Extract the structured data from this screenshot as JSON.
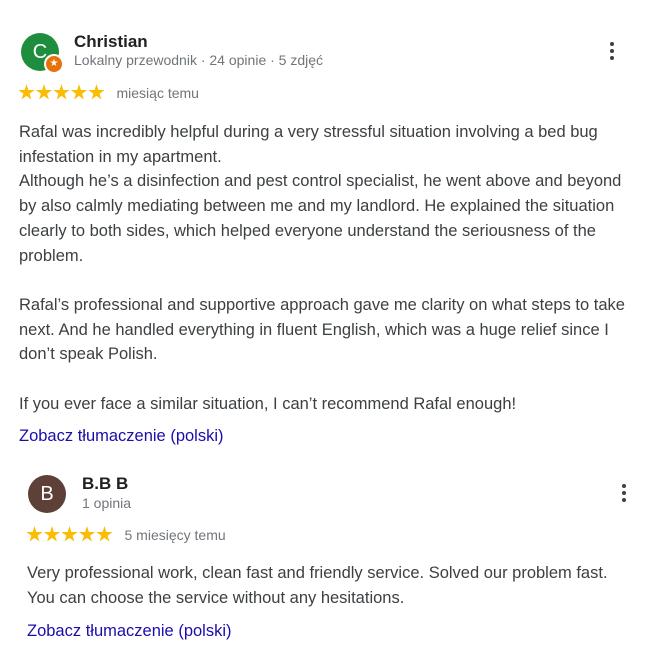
{
  "reviews": [
    {
      "avatar_letter": "C",
      "avatar_color": "#1e8e3e",
      "local_guide_badge": "★",
      "name": "Christian",
      "meta": "Lokalny przewodnik · 24 opinie · 5 zdjęć",
      "stars": 5,
      "time": "miesiąc temu",
      "text": "Rafal was incredibly helpful during a very stressful situation involving a bed bug infestation in my apartment.\nAlthough he’s a disinfection and pest control specialist, he went above and beyond by also calmly mediating between me and my landlord. He explained the situation clearly to both sides, which helped everyone understand the seriousness of the problem.\n\nRafal’s professional and supportive approach gave me clarity on what steps to take next. And he handled everything in fluent English, which was a huge relief since I don’t speak Polish.\n\nIf you ever face a similar situation, I can’t recommend Rafal enough!",
      "translate_link": "Zobacz tłumaczenie (polski)"
    },
    {
      "avatar_letter": "B",
      "avatar_color": "#5d4037",
      "name": "B.B B",
      "meta": "1 opinia",
      "stars": 5,
      "time": "5 miesięcy temu",
      "text": "Very professional work, clean fast and friendly service. Solved our problem fast. You can choose the service without any hesitations.",
      "translate_link": "Zobacz tłumaczenie (polski)"
    }
  ],
  "colors": {
    "star": "#fbbc04",
    "link": "#1a0dab",
    "text": "#3c4043",
    "secondary": "#70757a"
  },
  "icons": [
    "more-vert-icon",
    "star-icon",
    "local-guide-badge-icon"
  ]
}
